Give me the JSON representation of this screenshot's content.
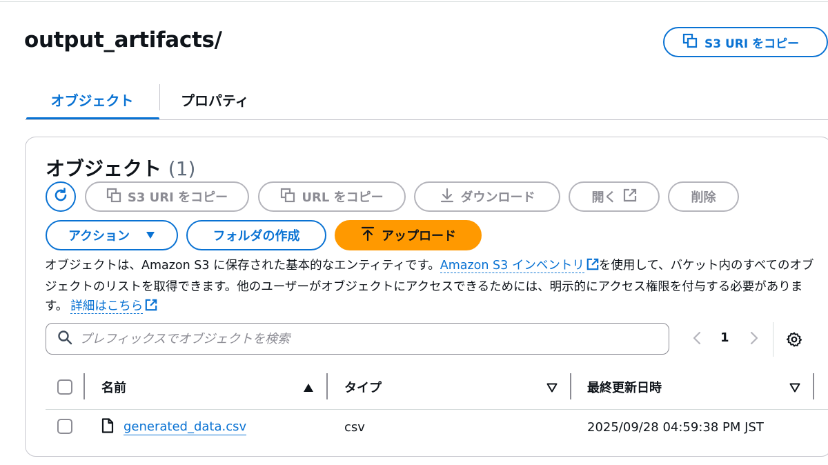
{
  "header": {
    "title": "output_artifacts/",
    "copy_uri_label": "S3 URI をコピー"
  },
  "tabs": [
    {
      "label": "オブジェクト",
      "active": true
    },
    {
      "label": "プロパティ",
      "active": false
    }
  ],
  "objects_panel": {
    "title": "オブジェクト",
    "count": "(1)",
    "toolbar": {
      "copy_uri_label": "S3 URI をコピー",
      "copy_url_label": "URL をコピー",
      "download_label": "ダウンロード",
      "open_label": "開く",
      "delete_label": "削除",
      "actions_label": "アクション",
      "create_folder_label": "フォルダの作成",
      "upload_label": "アップロード"
    },
    "description": {
      "part1": "オブジェクトは、Amazon S3 に保存された基本的なエンティティです。",
      "inventory_link": "Amazon S3 インベントリ",
      "part2": "を使用して、バケット内のすべてのオブジェクトのリストを取得できます。他のユーザーがオブジェクトにアクセスできるためには、明示的にアクセス権限を付与する必要があります。",
      "details_link": "詳細はこちら"
    },
    "search": {
      "placeholder": "プレフィックスでオブジェクトを検索",
      "value": ""
    },
    "pagination": {
      "current_page": "1"
    },
    "table": {
      "columns": [
        "名前",
        "タイプ",
        "最終更新日時"
      ],
      "rows": [
        {
          "name": "generated_data.csv",
          "type": "csv",
          "last_modified": "2025/09/28 04:59:38 PM JST"
        }
      ]
    }
  },
  "colors": {
    "accent": "#0972d3",
    "upload_button": "#ff9900",
    "disabled": "#8c8c94"
  },
  "icons": [
    "copy-icon",
    "refresh-icon",
    "download-icon",
    "external-link-icon",
    "caret-down-icon",
    "upload-icon",
    "search-icon",
    "chevron-left-icon",
    "chevron-right-icon",
    "settings-icon",
    "sort-ascending-icon",
    "sort-descending-icon",
    "file-icon"
  ]
}
